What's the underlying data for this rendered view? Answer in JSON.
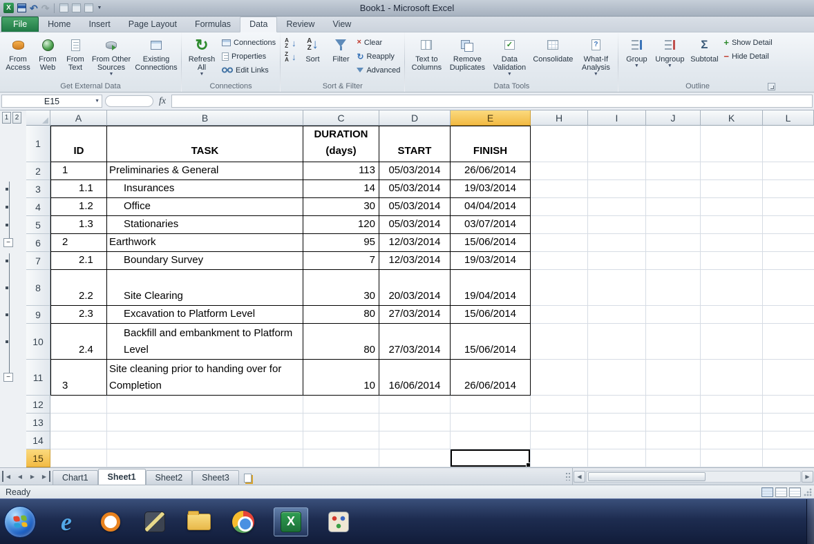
{
  "titlebar": {
    "title": "Book1 - Microsoft Excel"
  },
  "ribbon_tabs": {
    "file": "File",
    "home": "Home",
    "insert": "Insert",
    "page_layout": "Page Layout",
    "formulas": "Formulas",
    "data": "Data",
    "review": "Review",
    "view": "View"
  },
  "ribbon": {
    "get_external_data": {
      "label": "Get External Data",
      "from_access": "From Access",
      "from_web": "From Web",
      "from_text": "From Text",
      "from_other_sources": "From Other Sources",
      "existing_connections": "Existing Connections"
    },
    "connections": {
      "label": "Connections",
      "refresh_all": "Refresh All",
      "connections": "Connections",
      "properties": "Properties",
      "edit_links": "Edit Links"
    },
    "sort_filter": {
      "label": "Sort & Filter",
      "sort": "Sort",
      "filter": "Filter",
      "clear": "Clear",
      "reapply": "Reapply",
      "advanced": "Advanced"
    },
    "data_tools": {
      "label": "Data Tools",
      "text_to_columns": "Text to Columns",
      "remove_duplicates": "Remove Duplicates",
      "data_validation": "Data Validation",
      "consolidate": "Consolidate",
      "what_if_analysis": "What-If Analysis"
    },
    "outline": {
      "label": "Outline",
      "group": "Group",
      "ungroup": "Ungroup",
      "subtotal": "Subtotal",
      "show_detail": "Show Detail",
      "hide_detail": "Hide Detail"
    }
  },
  "formula_bar": {
    "name_box": "E15",
    "fx": "fx",
    "formula": ""
  },
  "grid": {
    "columns": [
      "A",
      "B",
      "C",
      "D",
      "E",
      "H",
      "I",
      "J",
      "K",
      "L"
    ],
    "row_numbers": [
      "1",
      "2",
      "3",
      "4",
      "5",
      "6",
      "7",
      "8",
      "9",
      "10",
      "11",
      "12",
      "13",
      "14",
      "15"
    ],
    "outline_level_1": "1",
    "outline_level_2": "2",
    "selected_cell": "E15"
  },
  "sheet": {
    "header": {
      "id": "ID",
      "task": "TASK",
      "duration_line1": "DURATION",
      "duration_line2": "(days)",
      "start": "START",
      "finish": "FINISH"
    },
    "rows": [
      {
        "id": "1",
        "task": "Preliminaries & General",
        "duration": "113",
        "start": "05/03/2014",
        "finish": "26/06/2014"
      },
      {
        "id": "1.1",
        "task": "Insurances",
        "duration": "14",
        "start": "05/03/2014",
        "finish": "19/03/2014"
      },
      {
        "id": "1.2",
        "task": "Office",
        "duration": "30",
        "start": "05/03/2014",
        "finish": "04/04/2014"
      },
      {
        "id": "1.3",
        "task": "Stationaries",
        "duration": "120",
        "start": "05/03/2014",
        "finish": "03/07/2014"
      },
      {
        "id": "2",
        "task": "Earthwork",
        "duration": "95",
        "start": "12/03/2014",
        "finish": "15/06/2014"
      },
      {
        "id": "2.1",
        "task": "Boundary Survey",
        "duration": "7",
        "start": "12/03/2014",
        "finish": "19/03/2014"
      },
      {
        "id": "2.2",
        "task": "Site Clearing",
        "duration": "30",
        "start": "20/03/2014",
        "finish": "19/04/2014"
      },
      {
        "id": "2.3",
        "task": "Excavation to Platform Level",
        "duration": "80",
        "start": "27/03/2014",
        "finish": "15/06/2014"
      },
      {
        "id": "2.4",
        "task": "Backfill and embankment to Platform Level",
        "duration": "80",
        "start": "27/03/2014",
        "finish": "15/06/2014"
      },
      {
        "id": "3",
        "task": "Site cleaning prior to handing over for Completion",
        "duration": "10",
        "start": "16/06/2014",
        "finish": "26/06/2014"
      }
    ]
  },
  "sheet_tabs": {
    "chart1": "Chart1",
    "sheet1": "Sheet1",
    "sheet2": "Sheet2",
    "sheet3": "Sheet3"
  },
  "status_bar": {
    "ready": "Ready"
  },
  "icons": {
    "dropdown": "▼",
    "down_arrow": "↓",
    "letter_a": "A",
    "letter_z": "Z",
    "refresh": "↻",
    "check": "✓",
    "question": "?",
    "sigma": "Σ",
    "plus": "+",
    "minus": "−",
    "undo": "↶",
    "redo": "↷",
    "nav_prev": "◀",
    "nav_next": "▶",
    "ie_e": "e",
    "excel_x": "X",
    "x_red": "×"
  }
}
